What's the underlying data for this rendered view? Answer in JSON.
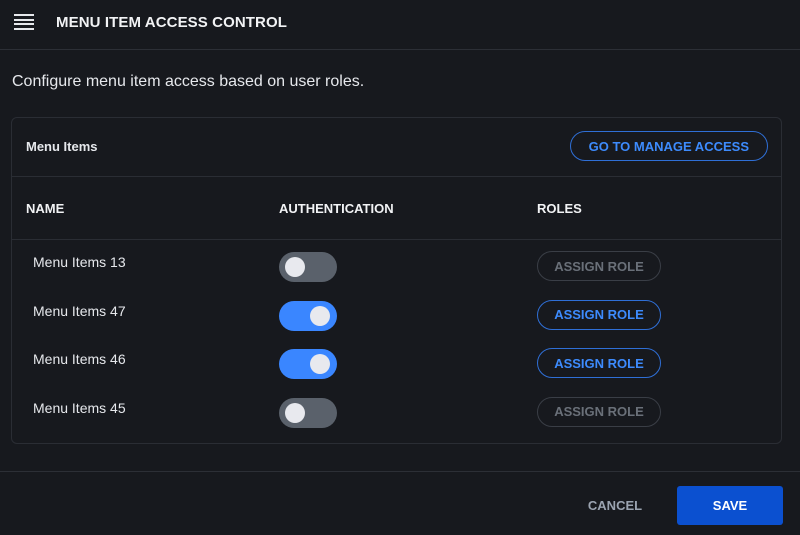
{
  "header": {
    "title": "MENU ITEM ACCESS CONTROL",
    "menu_icon": "hamburger-icon"
  },
  "description": "Configure menu item access based on user roles.",
  "card": {
    "title": "Menu Items",
    "manage_button": "GO TO MANAGE ACCESS",
    "columns": [
      "NAME",
      "AUTHENTICATION",
      "ROLES"
    ],
    "rows": [
      {
        "name": "Menu Items 13",
        "authentication": false,
        "role_button": "ASSIGN ROLE"
      },
      {
        "name": "Menu Items 47",
        "authentication": true,
        "role_button": "ASSIGN ROLE"
      },
      {
        "name": "Menu Items 46",
        "authentication": true,
        "role_button": "ASSIGN ROLE"
      },
      {
        "name": "Menu Items 45",
        "authentication": false,
        "role_button": "ASSIGN ROLE"
      }
    ]
  },
  "footer": {
    "cancel": "CANCEL",
    "save": "SAVE"
  },
  "colors": {
    "accent": "#3a86ff",
    "primary": "#0b50d0",
    "background": "#17191e"
  }
}
